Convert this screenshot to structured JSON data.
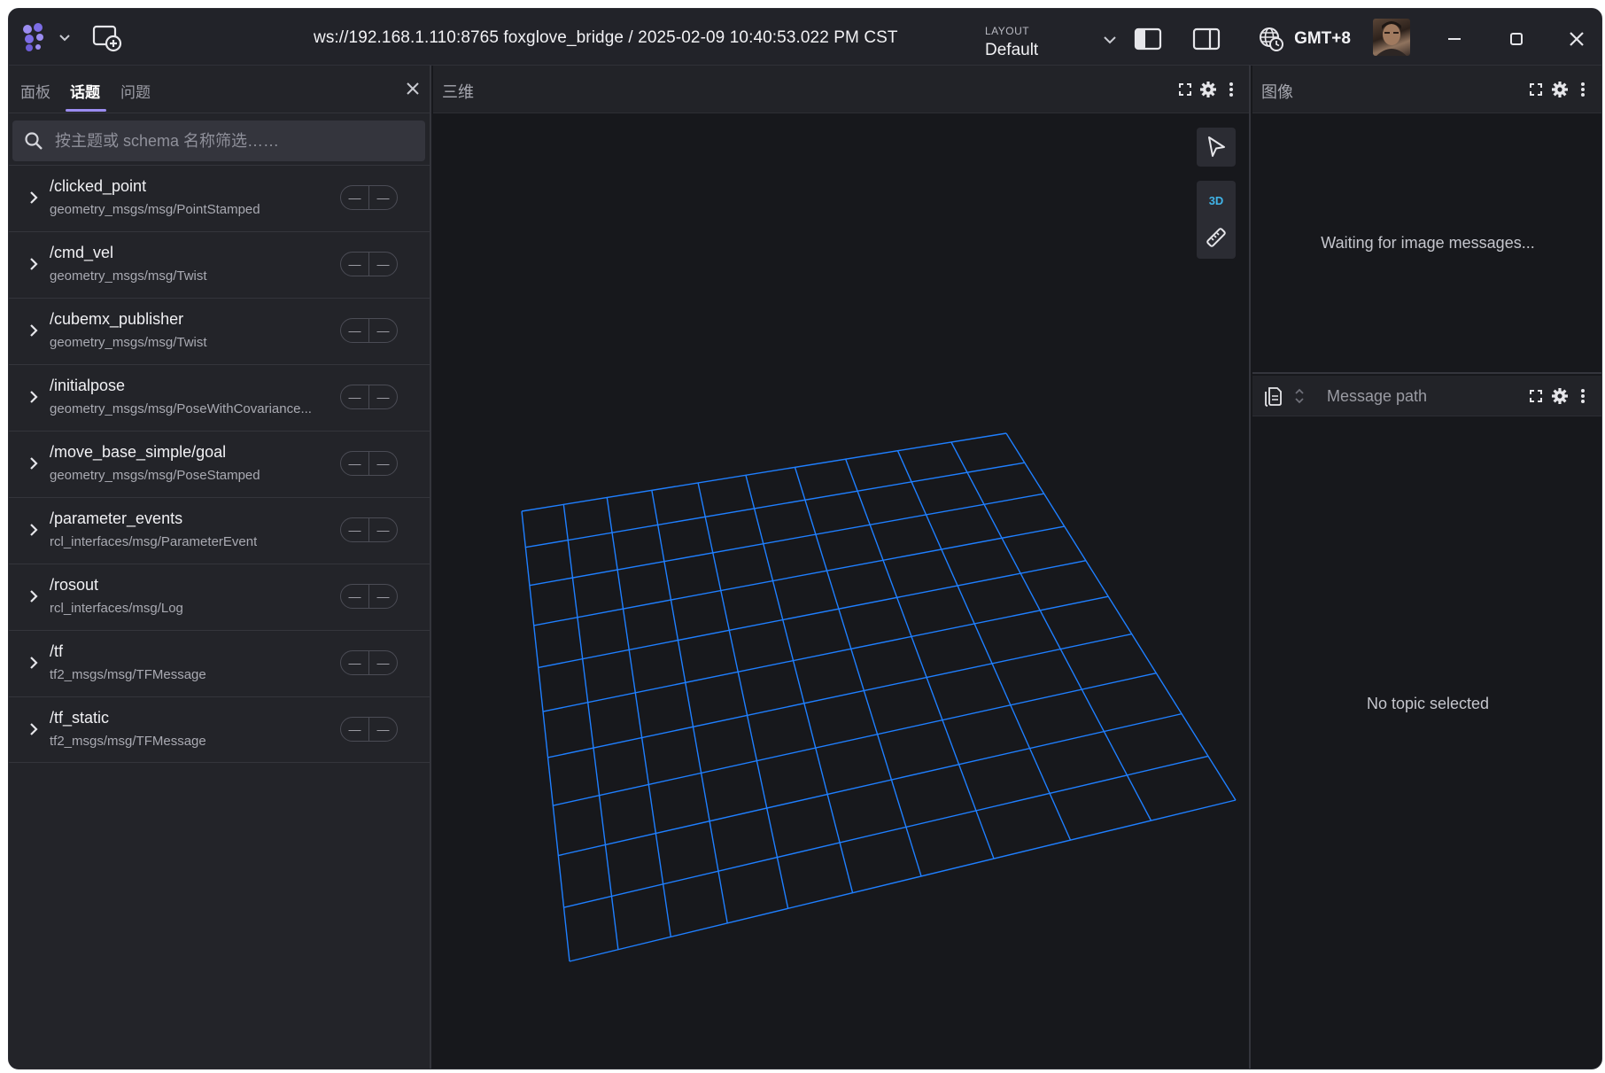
{
  "titlebar": {
    "connection_title": "ws://192.168.1.110:8765 foxglove_bridge / 2025-02-09 10:40:53.022 PM CST",
    "layout_caption": "LAYOUT",
    "layout_value": "Default",
    "timezone": "GMT+8",
    "icons": {
      "app_menu": "foxglove-logo-icon",
      "new_window": "new-window-icon",
      "left_sidebar": "left-sidebar-toggle-icon",
      "right_sidebar": "right-sidebar-toggle-icon",
      "timezone": "globe-clock-icon",
      "minimize": "minimize-icon",
      "maximize": "maximize-icon",
      "close": "close-icon"
    }
  },
  "sidebar": {
    "tabs": [
      {
        "label": "面板",
        "active": false
      },
      {
        "label": "话题",
        "active": true
      },
      {
        "label": "问题",
        "active": false
      }
    ],
    "search_placeholder": "按主题或 schema 名称筛选……",
    "topics": [
      {
        "name": "/clicked_point",
        "schema": "geometry_msgs/msg/PointStamped",
        "freq": "—",
        "bw": "—"
      },
      {
        "name": "/cmd_vel",
        "schema": "geometry_msgs/msg/Twist",
        "freq": "—",
        "bw": "—"
      },
      {
        "name": "/cubemx_publisher",
        "schema": "geometry_msgs/msg/Twist",
        "freq": "—",
        "bw": "—"
      },
      {
        "name": "/initialpose",
        "schema": "geometry_msgs/msg/PoseWithCovariance...",
        "freq": "—",
        "bw": "—"
      },
      {
        "name": "/move_base_simple/goal",
        "schema": "geometry_msgs/msg/PoseStamped",
        "freq": "—",
        "bw": "—"
      },
      {
        "name": "/parameter_events",
        "schema": "rcl_interfaces/msg/ParameterEvent",
        "freq": "—",
        "bw": "—"
      },
      {
        "name": "/rosout",
        "schema": "rcl_interfaces/msg/Log",
        "freq": "—",
        "bw": "—"
      },
      {
        "name": "/tf",
        "schema": "tf2_msgs/msg/TFMessage",
        "freq": "—",
        "bw": "—"
      },
      {
        "name": "/tf_static",
        "schema": "tf2_msgs/msg/TFMessage",
        "freq": "—",
        "bw": "—"
      }
    ]
  },
  "panel3d": {
    "title": "三维",
    "mode_label": "3D",
    "grid_color": "#1f7fff"
  },
  "image_panel": {
    "title": "图像",
    "waiting_text": "Waiting for image messages..."
  },
  "plot_panel": {
    "message_path_placeholder": "Message path",
    "empty_text": "No topic selected"
  }
}
